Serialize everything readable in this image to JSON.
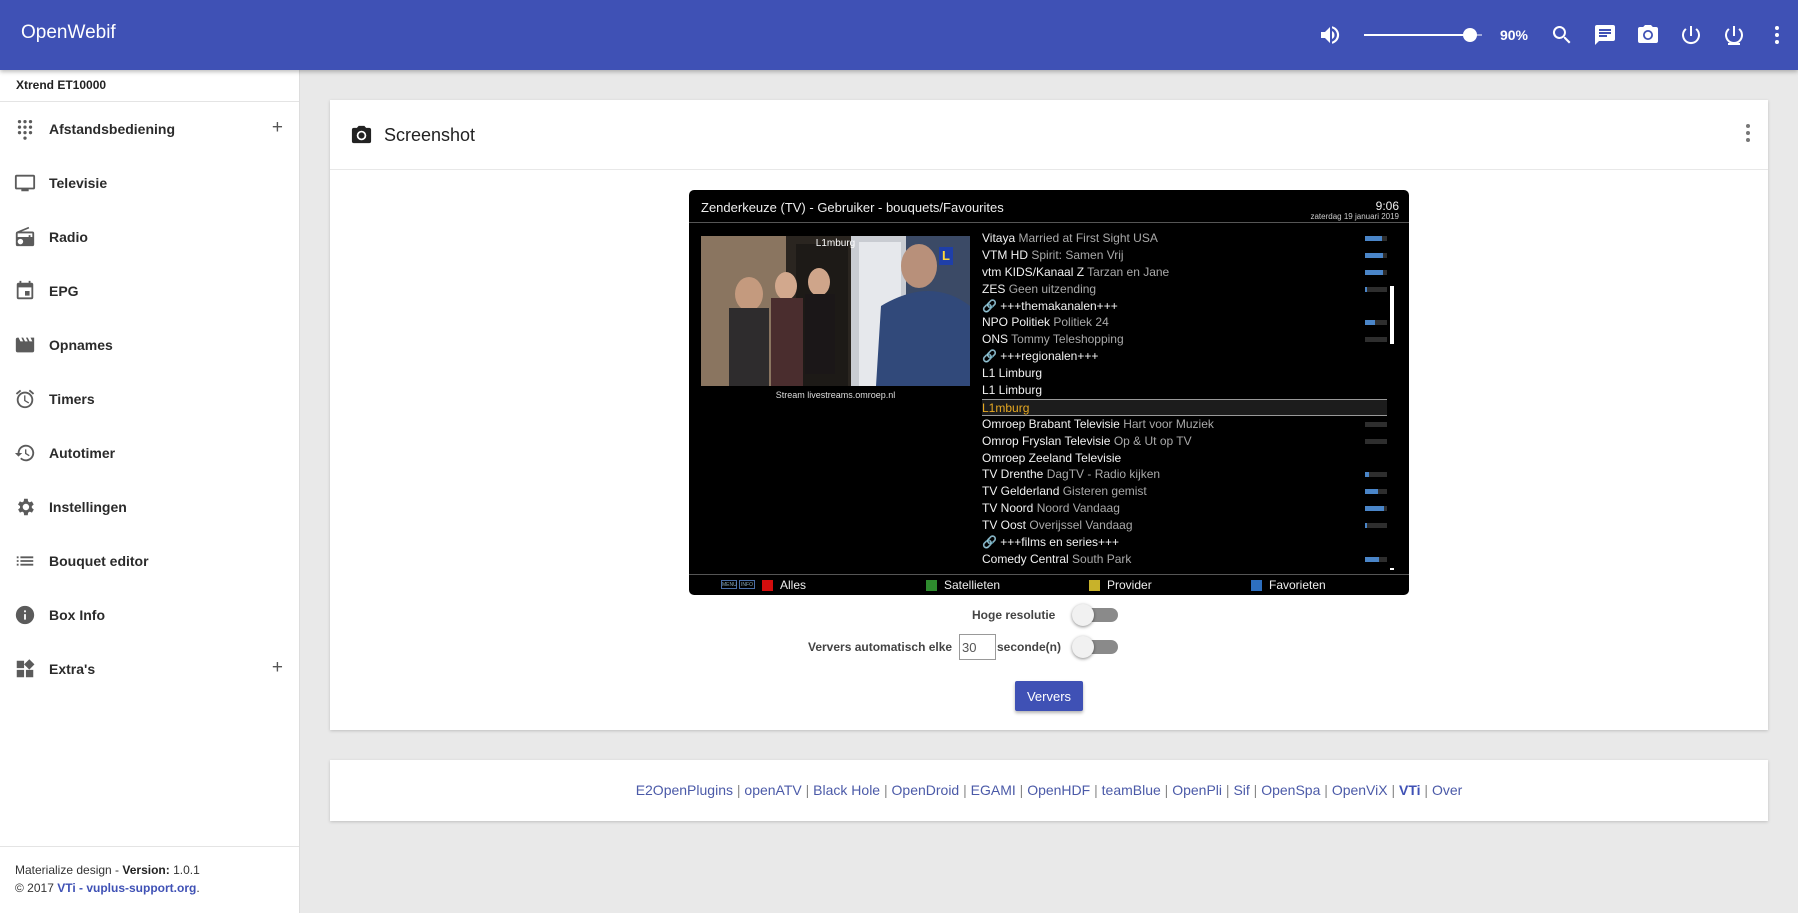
{
  "app": {
    "title": "OpenWebif",
    "volume_pct": "90%",
    "volume_level": 0.9,
    "accent_color": "#3f51b5",
    "toolbar_icons": [
      "volume-icon",
      "search-icon",
      "message-icon",
      "camera-icon",
      "power-icon",
      "standby-icon",
      "more-vert-icon"
    ]
  },
  "sidebar": {
    "device": "Xtrend ET10000",
    "items": [
      {
        "label": "Afstandsbediening",
        "icon": "remote-dots-icon",
        "expandable": true
      },
      {
        "label": "Televisie",
        "icon": "tv-icon"
      },
      {
        "label": "Radio",
        "icon": "radio-icon"
      },
      {
        "label": "EPG",
        "icon": "calendar-icon"
      },
      {
        "label": "Opnames",
        "icon": "movie-icon"
      },
      {
        "label": "Timers",
        "icon": "alarm-icon"
      },
      {
        "label": "Autotimer",
        "icon": "history-icon"
      },
      {
        "label": "Instellingen",
        "icon": "settings-icon"
      },
      {
        "label": "Bouquet editor",
        "icon": "list-icon"
      },
      {
        "label": "Box Info",
        "icon": "info-icon"
      },
      {
        "label": "Extra's",
        "icon": "dashboard-icon",
        "expandable": true
      }
    ],
    "footer": {
      "design": "Materialize design - ",
      "version_label": "Version:",
      "version": " 1.0.1",
      "copyright": "© 2017 ",
      "link": "VTi - vuplus-support.org",
      "dot": "."
    }
  },
  "card": {
    "title": "Screenshot"
  },
  "tv": {
    "title": "Zenderkeuze (TV) - Gebruiker - bouquets/Favourites",
    "time": "9:06",
    "date": "zaterdag 19 januari 2019",
    "pip_label": "L1mburg",
    "stream": "Stream livestreams.omroep.nl",
    "channels": [
      {
        "name": "Vitaya",
        "event": "Married at First Sight USA",
        "progress": 0.75
      },
      {
        "name": "VTM HD",
        "event": "Spirit: Samen Vrij",
        "progress": 0.8
      },
      {
        "name": "vtm KIDS/Kanaal Z",
        "event": "Tarzan en Jane",
        "progress": 0.8
      },
      {
        "name": "ZES",
        "event": "Geen uitzending",
        "progress": 0.1
      },
      {
        "name": "🔗 +++themakanalen+++",
        "event": ""
      },
      {
        "name": "NPO Politiek",
        "event": "Politiek 24",
        "progress": 0.45
      },
      {
        "name": "ONS",
        "event": "Tommy Teleshopping",
        "progress": 0.0
      },
      {
        "name": "🔗 +++regionalen+++",
        "event": ""
      },
      {
        "name": "L1 Limburg",
        "event": ""
      },
      {
        "name": "L1 Limburg",
        "event": ""
      },
      {
        "name": "L1mburg",
        "event": "",
        "selected": true
      },
      {
        "name": "Omroep Brabant Televisie",
        "event": "Hart voor Muziek",
        "progress": 0.0
      },
      {
        "name": "Omrop Fryslan Televisie",
        "event": "Op & Ut op TV",
        "progress": 0.0
      },
      {
        "name": "Omroep Zeeland Televisie",
        "event": ""
      },
      {
        "name": "TV Drenthe",
        "event": "DagTV - Radio kijken",
        "progress": 0.2
      },
      {
        "name": "TV Gelderland",
        "event": "Gisteren gemist",
        "progress": 0.6
      },
      {
        "name": "TV Noord",
        "event": "Noord Vandaag",
        "progress": 0.85
      },
      {
        "name": "TV Oost",
        "event": "Overijssel Vandaag",
        "progress": 0.1
      },
      {
        "name": "🔗 +++films en series+++",
        "event": ""
      },
      {
        "name": "Comedy Central",
        "event": "South Park",
        "progress": 0.65
      }
    ],
    "footer": {
      "keys": [
        "MENU",
        "INFO"
      ],
      "red": "Alles",
      "green": "Satellieten",
      "yellow": "Provider",
      "blue": "Favorieten"
    }
  },
  "controls": {
    "hires_label": "Hoge resolutie",
    "auto_label": "Ververs automatisch elke",
    "interval_value": "30",
    "seconds_label": "seconde(n)",
    "refresh_button": "Ververs",
    "hires_on": false,
    "auto_on": false
  },
  "links": {
    "items": [
      "E2OpenPlugins",
      "openATV",
      "Black Hole",
      "OpenDroid",
      "EGAMI",
      "OpenHDF",
      "teamBlue",
      "OpenPli",
      "Sif",
      "OpenSpa",
      "OpenViX",
      "VTi",
      "Over"
    ],
    "separator": " | "
  }
}
